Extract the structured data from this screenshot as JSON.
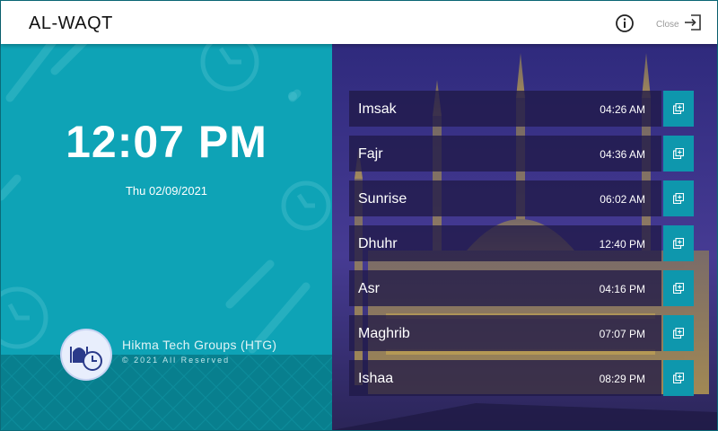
{
  "header": {
    "title": "AL-WAQT",
    "info_icon": "info-circle-icon",
    "close_label": "Close",
    "close_icon": "exit-door-icon"
  },
  "clock": {
    "time": "12:07 PM",
    "date": "Thu 02/09/2021"
  },
  "footer": {
    "company": "Hikma Tech Groups (HTG)",
    "copyright": "© 2021 All Reserved",
    "logo_icon": "mosque-clock-logo"
  },
  "prayers": [
    {
      "name": "Imsak",
      "time": "04:26 AM"
    },
    {
      "name": "Fajr",
      "time": "04:36 AM"
    },
    {
      "name": "Sunrise",
      "time": "06:02 AM"
    },
    {
      "name": "Dhuhr",
      "time": "12:40 PM"
    },
    {
      "name": "Asr",
      "time": "04:16 PM"
    },
    {
      "name": "Maghrib",
      "time": "07:07 PM"
    },
    {
      "name": "Ishaa",
      "time": "08:29 PM"
    }
  ],
  "prayer_button_icon": "add-to-collection-icon",
  "colors": {
    "accent": "#0ea3b6",
    "footer": "#087f8e",
    "button": "#0e97ad"
  }
}
